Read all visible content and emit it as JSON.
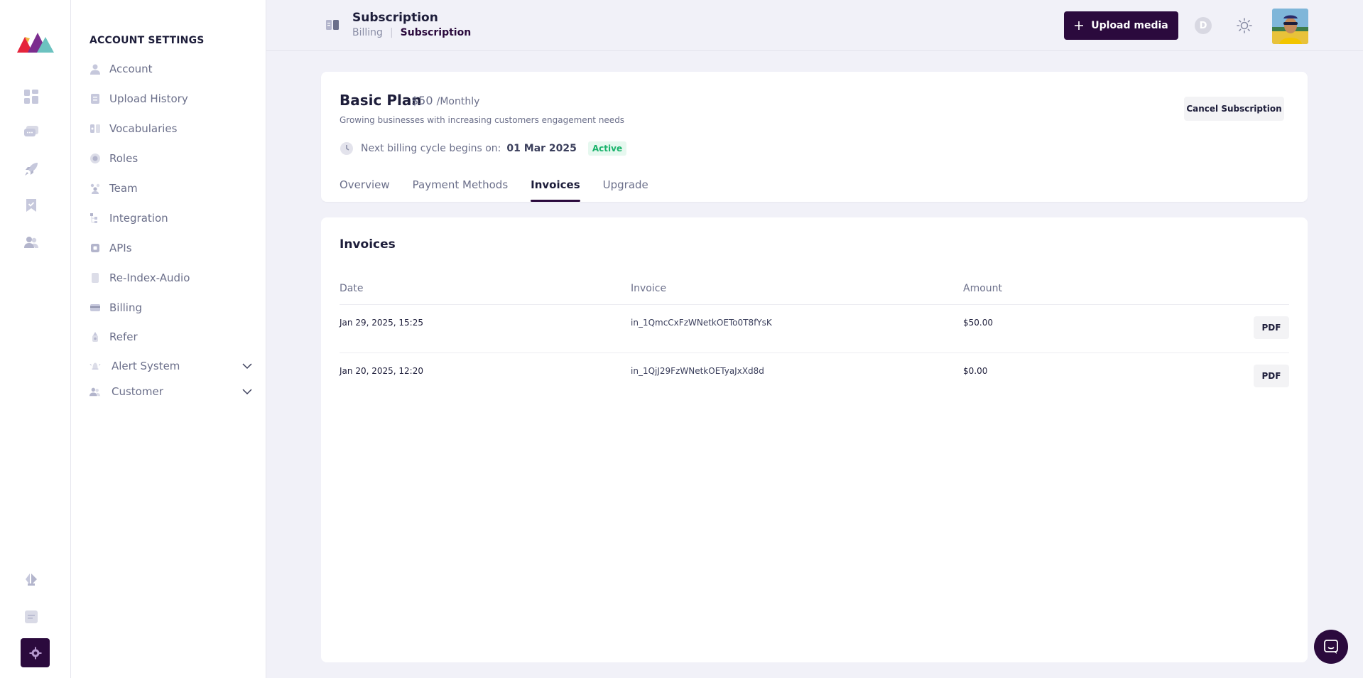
{
  "sidebar": {
    "title": "ACCOUNT SETTINGS",
    "items": [
      {
        "label": "Account",
        "icon": "user-icon"
      },
      {
        "label": "Upload History",
        "icon": "history-icon"
      },
      {
        "label": "Vocabularies",
        "icon": "vocabulary-icon"
      },
      {
        "label": "Roles",
        "icon": "roles-icon"
      },
      {
        "label": "Team",
        "icon": "team-icon"
      },
      {
        "label": "Integration",
        "icon": "integration-icon"
      },
      {
        "label": "APIs",
        "icon": "api-icon"
      },
      {
        "label": "Re-Index-Audio",
        "icon": "audio-icon"
      },
      {
        "label": "Billing",
        "icon": "billing-icon"
      },
      {
        "label": "Refer",
        "icon": "refer-icon"
      },
      {
        "label": "Alert System",
        "icon": "alert-icon",
        "expandable": true
      },
      {
        "label": "Customer",
        "icon": "customer-icon",
        "expandable": true
      }
    ]
  },
  "header": {
    "title": "Subscription",
    "breadcrumb": [
      "Billing",
      "Subscription"
    ],
    "upload_label": "Upload media",
    "user_initial": "D"
  },
  "plan": {
    "name": "Basic Plan",
    "price": "$50",
    "period": "/Monthly",
    "description": "Growing businesses with increasing customers engagement needs",
    "billing_label": "Next billing cycle begins on:",
    "billing_date": "01 Mar 2025",
    "status": "Active",
    "cancel_label": "Cancel Subscription",
    "tabs": [
      "Overview",
      "Payment Methods",
      "Invoices",
      "Upgrade"
    ],
    "active_tab": "Invoices"
  },
  "invoices": {
    "title": "Invoices",
    "columns": [
      "Date",
      "Invoice",
      "Amount"
    ],
    "rows": [
      {
        "date": "Jan 29, 2025, 15:25",
        "invoice": "in_1QmcCxFzWNetkOETo0T8fYsK",
        "amount": "$50.00",
        "action": "PDF"
      },
      {
        "date": "Jan 20, 2025, 12:20",
        "invoice": "in_1QjJ29FzWNetkOETyaJxXd8d",
        "amount": "$0.00",
        "action": "PDF"
      }
    ]
  },
  "colors": {
    "brand": "#2b0a3d",
    "active_badge": "#19b36b",
    "background": "#f1f1f8"
  }
}
